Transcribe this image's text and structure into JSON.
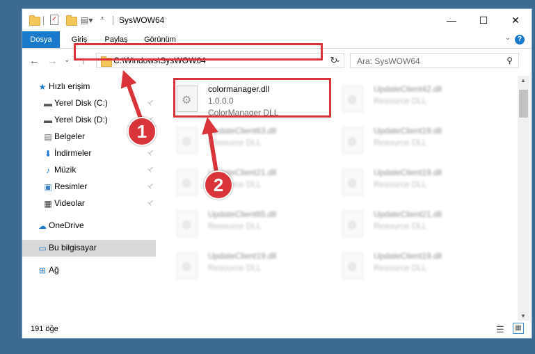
{
  "window": {
    "title": "SysWOW64",
    "minimize": "—",
    "maximize": "☐",
    "close": "✕"
  },
  "ribbon": {
    "tabs": [
      "Dosya",
      "Giriş",
      "Paylaş",
      "Görünüm"
    ],
    "help": "?",
    "expand": "⌄"
  },
  "nav": {
    "back": "←",
    "forward": "→",
    "recent": "⌄",
    "up": "↑",
    "address": "C:\\Windows\\SysWOW64",
    "address_dropdown": "⌄",
    "refresh": "↻",
    "search_placeholder": "Ara: SysWOW64",
    "search_icon": "⚲"
  },
  "sidebar": {
    "items": [
      {
        "label": "Hızlı erişim",
        "icon": "star-icon",
        "glyph": "★",
        "color": "#1979ca",
        "pinned": false
      },
      {
        "label": "Yerel Disk (C:)",
        "icon": "drive-icon",
        "glyph": "▬",
        "color": "#555555",
        "pinned": true
      },
      {
        "label": "Yerel Disk (D:)",
        "icon": "drive-icon",
        "glyph": "▬",
        "color": "#555555",
        "pinned": true
      },
      {
        "label": "Belgeler",
        "icon": "documents-icon",
        "glyph": "▤",
        "color": "#6d6d6d",
        "pinned": true
      },
      {
        "label": "İndirmeler",
        "icon": "download-icon",
        "glyph": "⬇",
        "color": "#1979ca",
        "pinned": true
      },
      {
        "label": "Müzik",
        "icon": "music-icon",
        "glyph": "♪",
        "color": "#1979ca",
        "pinned": true
      },
      {
        "label": "Resimler",
        "icon": "pictures-icon",
        "glyph": "▣",
        "color": "#3b7fc4",
        "pinned": true
      },
      {
        "label": "Videolar",
        "icon": "video-icon",
        "glyph": "▦",
        "color": "#333333",
        "pinned": true
      },
      {
        "label": "OneDrive",
        "icon": "cloud-icon",
        "glyph": "☁",
        "color": "#1979ca",
        "pinned": false
      },
      {
        "label": "Bu bilgisayar",
        "icon": "computer-icon",
        "glyph": "▭",
        "color": "#1979ca",
        "pinned": false
      },
      {
        "label": "Ağ",
        "icon": "network-icon",
        "glyph": "⊞",
        "color": "#1979ca",
        "pinned": false
      }
    ],
    "pin_glyph": "📌"
  },
  "files": {
    "highlighted": {
      "name": "colormanager.dll",
      "version": "1.0.0.0",
      "description": "ColorManager DLL"
    },
    "others": [
      {
        "name": "UpdateClient42.dll",
        "type": "Resource DLL"
      },
      {
        "name": "UpdateClient63.dll",
        "type": "Resource DLL"
      },
      {
        "name": "UpdateClient19.dll",
        "type": "Resource DLL"
      },
      {
        "name": "UpdateClient21.dll",
        "type": "Resource DLL"
      },
      {
        "name": "UpdateClient19.dll",
        "type": "Resource DLL"
      },
      {
        "name": "UpdateClient65.dll",
        "type": "Resource DLL"
      },
      {
        "name": "UpdateClient21.dll",
        "type": "Resource DLL"
      },
      {
        "name": "UpdateClient19.dll",
        "type": "Resource DLL"
      },
      {
        "name": "UpdateClient19.dll",
        "type": "Resource DLL"
      }
    ]
  },
  "status": {
    "count": "191 öğe"
  },
  "annotations": {
    "step1": "1",
    "step2": "2",
    "color": "#d9343a"
  }
}
